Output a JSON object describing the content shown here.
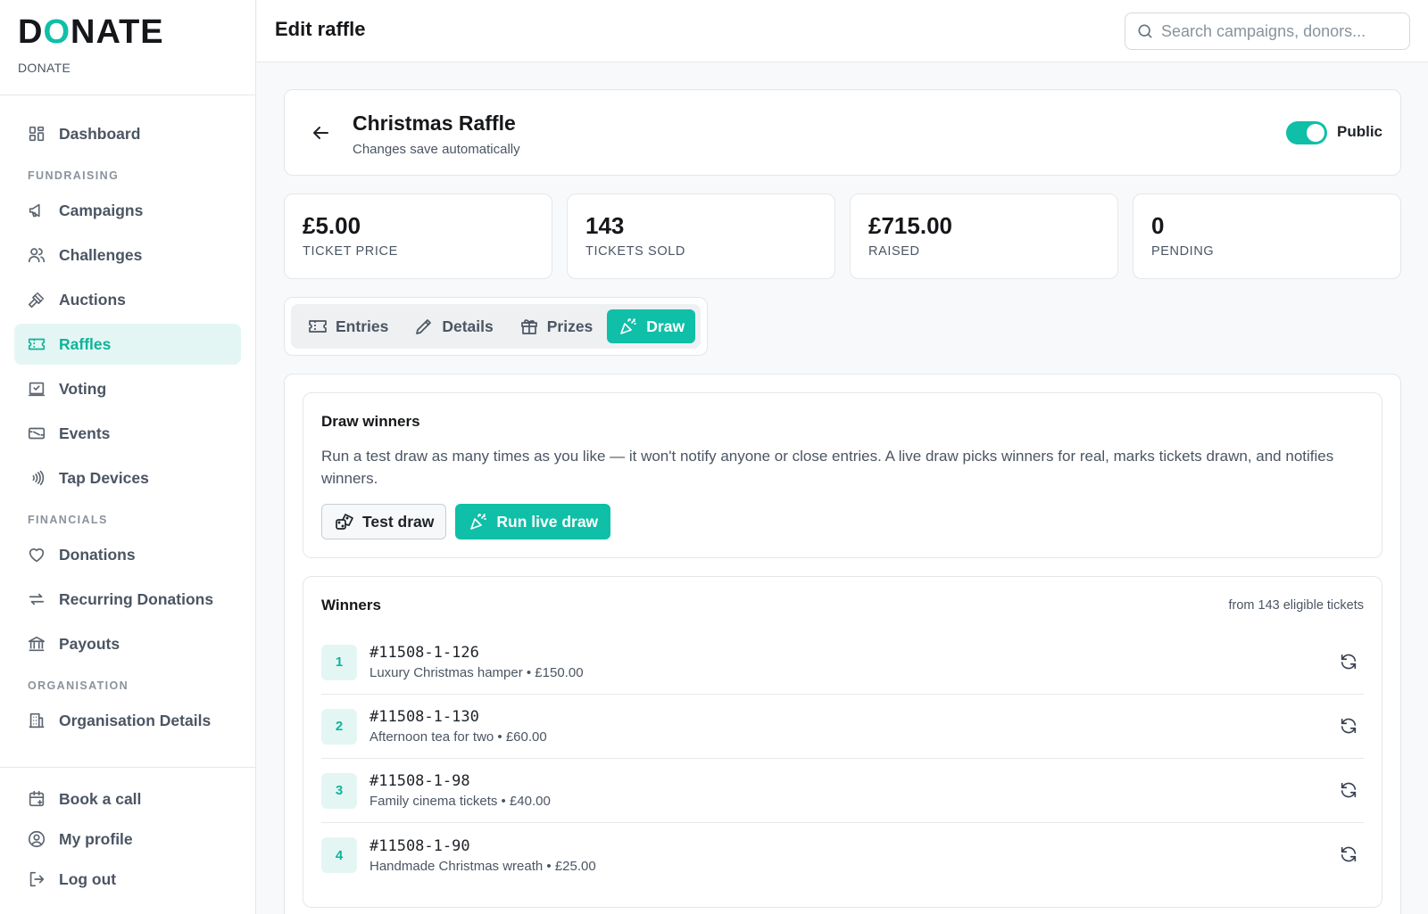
{
  "brand": {
    "logo_pre": "D",
    "logo_o": "O",
    "logo_post": "NATE",
    "subtitle": "DONATE"
  },
  "sidebar": {
    "dashboard": "Dashboard",
    "sections": {
      "fundraising": "FUNDRAISING",
      "financials": "FINANCIALS",
      "organisation": "ORGANISATION"
    },
    "items": {
      "campaigns": "Campaigns",
      "challenges": "Challenges",
      "auctions": "Auctions",
      "raffles": "Raffles",
      "voting": "Voting",
      "events": "Events",
      "tap_devices": "Tap Devices",
      "donations": "Donations",
      "recurring": "Recurring Donations",
      "payouts": "Payouts",
      "org_details": "Organisation Details"
    },
    "active": "Raffles",
    "bottom": {
      "book_call": "Book a call",
      "profile": "My profile",
      "logout": "Log out"
    }
  },
  "header": {
    "title": "Edit raffle",
    "search_placeholder": "Search campaigns, donors..."
  },
  "raffle": {
    "title": "Christmas Raffle",
    "subtitle": "Changes save automatically",
    "visibility_label": "Public",
    "public": true
  },
  "stats": [
    {
      "value": "£5.00",
      "label": "TICKET PRICE"
    },
    {
      "value": "143",
      "label": "TICKETS SOLD"
    },
    {
      "value": "£715.00",
      "label": "RAISED"
    },
    {
      "value": "0",
      "label": "PENDING"
    }
  ],
  "tabs": {
    "entries": "Entries",
    "details": "Details",
    "prizes": "Prizes",
    "draw": "Draw",
    "active": "Draw"
  },
  "draw": {
    "title": "Draw winners",
    "description": "Run a test draw as many times as you like — it won't notify anyone or close entries. A live draw picks winners for real, marks tickets drawn, and notifies winners.",
    "test_label": "Test draw",
    "live_label": "Run live draw"
  },
  "winners": {
    "title": "Winners",
    "eligible": "from 143 eligible tickets",
    "list": [
      {
        "rank": "1",
        "ticket": "#11508-1-126",
        "prize": "Luxury Christmas hamper • £150.00"
      },
      {
        "rank": "2",
        "ticket": "#11508-1-130",
        "prize": "Afternoon tea for two • £60.00"
      },
      {
        "rank": "3",
        "ticket": "#11508-1-98",
        "prize": "Family cinema tickets • £40.00"
      },
      {
        "rank": "4",
        "ticket": "#11508-1-90",
        "prize": "Handmade Christmas wreath • £25.00"
      }
    ]
  },
  "colors": {
    "accent": "#0fbfa7",
    "accent_bg": "#e4f6f3"
  }
}
